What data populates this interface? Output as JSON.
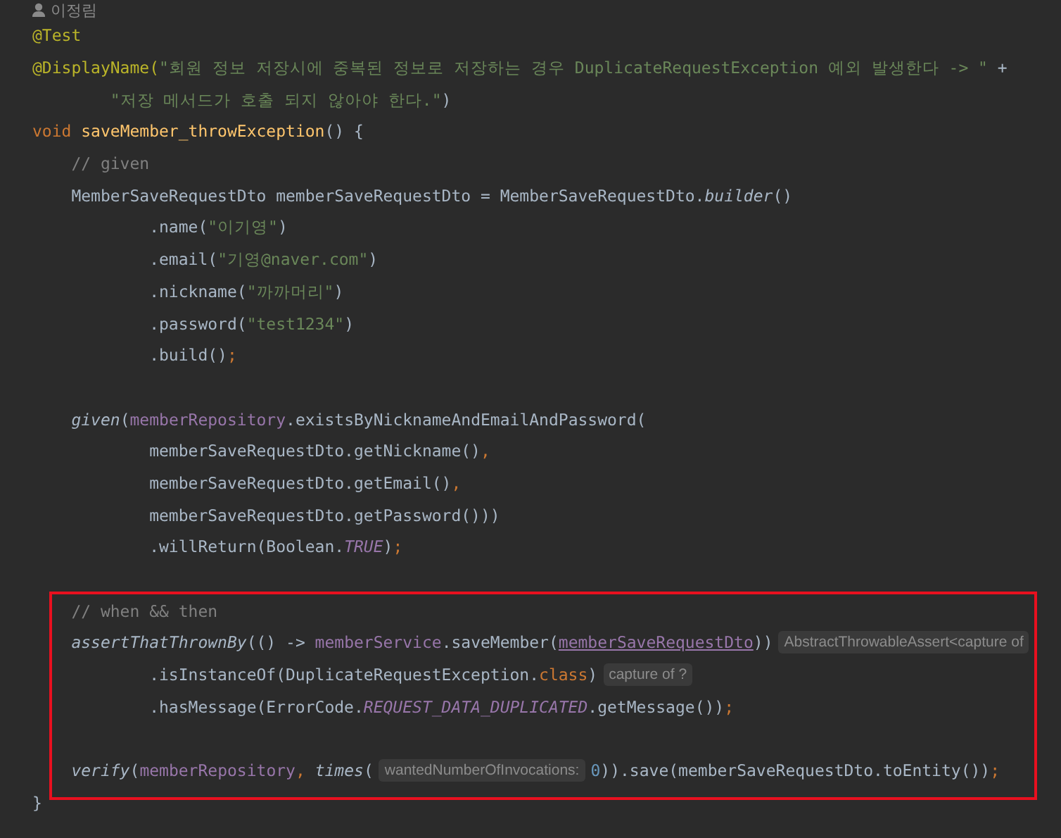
{
  "author": {
    "text": "이정림"
  },
  "lines": [
    {
      "kind": "code",
      "tokens": [
        {
          "kind": "annotation",
          "text": "@Test"
        }
      ]
    },
    {
      "kind": "code",
      "tokens": [
        {
          "kind": "annotation",
          "text": "@DisplayName("
        },
        {
          "kind": "string",
          "text": "\"회원 정보 저장시에 중복된 정보로 저장하는 경우 DuplicateRequestException 예외 발생한다 -> \""
        },
        {
          "kind": "plain",
          "text": " +"
        }
      ]
    },
    {
      "kind": "code",
      "tokens": [
        {
          "kind": "string",
          "text": "        \"저장 메서드가 호출 되지 않아야 한다.\""
        },
        {
          "kind": "plain",
          "text": ")"
        }
      ]
    },
    {
      "kind": "code",
      "tokens": [
        {
          "kind": "keyword",
          "text": "void "
        },
        {
          "kind": "method",
          "text": "saveMember_throwException"
        },
        {
          "kind": "plain",
          "text": "() {"
        }
      ]
    },
    {
      "kind": "code",
      "tokens": [
        {
          "kind": "comment",
          "text": "    // given"
        }
      ]
    },
    {
      "kind": "code",
      "tokens": [
        {
          "kind": "plain",
          "text": "    MemberSaveRequestDto memberSaveRequestDto = MemberSaveRequestDto."
        },
        {
          "kind": "italic",
          "text": "builder"
        },
        {
          "kind": "plain",
          "text": "()"
        }
      ]
    },
    {
      "kind": "code",
      "tokens": [
        {
          "kind": "plain",
          "text": "            .name("
        },
        {
          "kind": "string",
          "text": "\"이기영\""
        },
        {
          "kind": "plain",
          "text": ")"
        }
      ]
    },
    {
      "kind": "code",
      "tokens": [
        {
          "kind": "plain",
          "text": "            .email("
        },
        {
          "kind": "string",
          "text": "\"기영@naver.com\""
        },
        {
          "kind": "plain",
          "text": ")"
        }
      ]
    },
    {
      "kind": "code",
      "tokens": [
        {
          "kind": "plain",
          "text": "            .nickname("
        },
        {
          "kind": "string",
          "text": "\"까까머리\""
        },
        {
          "kind": "plain",
          "text": ")"
        }
      ]
    },
    {
      "kind": "code",
      "tokens": [
        {
          "kind": "plain",
          "text": "            .password("
        },
        {
          "kind": "string",
          "text": "\"test1234\""
        },
        {
          "kind": "plain",
          "text": ")"
        }
      ]
    },
    {
      "kind": "code",
      "tokens": [
        {
          "kind": "plain",
          "text": "            .build()"
        },
        {
          "kind": "keyword",
          "text": ";"
        }
      ]
    },
    {
      "kind": "blank"
    },
    {
      "kind": "code",
      "tokens": [
        {
          "kind": "italic",
          "text": "    given"
        },
        {
          "kind": "plain",
          "text": "("
        },
        {
          "kind": "field",
          "text": "memberRepository"
        },
        {
          "kind": "plain",
          "text": ".existsByNicknameAndEmailAndPassword("
        }
      ]
    },
    {
      "kind": "code",
      "tokens": [
        {
          "kind": "plain",
          "text": "            memberSaveRequestDto.getNickname()"
        },
        {
          "kind": "keyword",
          "text": ","
        }
      ]
    },
    {
      "kind": "code",
      "tokens": [
        {
          "kind": "plain",
          "text": "            memberSaveRequestDto.getEmail()"
        },
        {
          "kind": "keyword",
          "text": ","
        }
      ]
    },
    {
      "kind": "code",
      "tokens": [
        {
          "kind": "plain",
          "text": "            memberSaveRequestDto.getPassword()))"
        }
      ]
    },
    {
      "kind": "code",
      "tokens": [
        {
          "kind": "plain",
          "text": "            .willReturn(Boolean."
        },
        {
          "kind": "constant",
          "text": "TRUE"
        },
        {
          "kind": "plain",
          "text": ")"
        },
        {
          "kind": "keyword",
          "text": ";"
        }
      ]
    },
    {
      "kind": "blank"
    },
    {
      "kind": "code",
      "tokens": [
        {
          "kind": "comment",
          "text": "    // when && then"
        }
      ]
    },
    {
      "kind": "code",
      "tokens": [
        {
          "kind": "italic",
          "text": "    assertThatThrownBy"
        },
        {
          "kind": "plain",
          "text": "(() -> "
        },
        {
          "kind": "field",
          "text": "memberService"
        },
        {
          "kind": "plain",
          "text": ".saveMember("
        },
        {
          "kind": "param",
          "text": "memberSaveRequestDto"
        },
        {
          "kind": "plain",
          "text": "))"
        },
        {
          "kind": "hint",
          "text": "AbstractThrowableAssert<capture of"
        }
      ]
    },
    {
      "kind": "code",
      "tokens": [
        {
          "kind": "plain",
          "text": "            .isInstanceOf(DuplicateRequestException."
        },
        {
          "kind": "keyword",
          "text": "class"
        },
        {
          "kind": "plain",
          "text": ")"
        },
        {
          "kind": "hint",
          "text": "capture of ?"
        }
      ]
    },
    {
      "kind": "code",
      "tokens": [
        {
          "kind": "plain",
          "text": "            .hasMessage(ErrorCode."
        },
        {
          "kind": "constant",
          "text": "REQUEST_DATA_DUPLICATED"
        },
        {
          "kind": "plain",
          "text": ".getMessage())"
        },
        {
          "kind": "keyword",
          "text": ";"
        }
      ]
    },
    {
      "kind": "blank"
    },
    {
      "kind": "code",
      "tokens": [
        {
          "kind": "italic",
          "text": "    verify"
        },
        {
          "kind": "plain",
          "text": "("
        },
        {
          "kind": "field",
          "text": "memberRepository"
        },
        {
          "kind": "keyword",
          "text": ", "
        },
        {
          "kind": "italic",
          "text": "times"
        },
        {
          "kind": "plain",
          "text": "("
        },
        {
          "kind": "hint",
          "text": "wantedNumberOfInvocations:"
        },
        {
          "kind": "number",
          "text": "0"
        },
        {
          "kind": "plain",
          "text": ")).save(memberSaveRequestDto.toEntity())"
        },
        {
          "kind": "keyword",
          "text": ";"
        }
      ]
    },
    {
      "kind": "code",
      "tokens": [
        {
          "kind": "plain",
          "text": "}"
        }
      ]
    }
  ]
}
